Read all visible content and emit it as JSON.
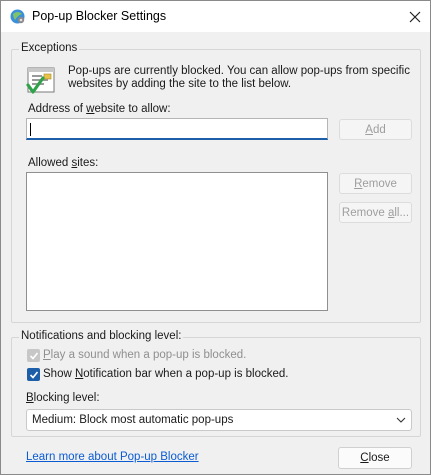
{
  "window": {
    "title": "Pop-up Blocker Settings",
    "close_glyph": "×",
    "app_icon": "ie-settings-icon"
  },
  "exceptions": {
    "group_title": "Exceptions",
    "info_line1": "Pop-ups are currently blocked.  You can allow pop-ups from specific",
    "info_line2": "websites by adding the site to the list below.",
    "address_label_pre": "Address of ",
    "address_label_key": "w",
    "address_label_post": "ebsite to allow:",
    "address_value": "",
    "add_button_key": "A",
    "add_button_rest": "dd",
    "allowed_label_pre": "Allowed ",
    "allowed_label_key": "s",
    "allowed_label_post": "ites:",
    "allowed_sites": [],
    "remove_button_key": "R",
    "remove_button_rest": "emove",
    "remove_all_button_pre": "Remove ",
    "remove_all_button_key": "a",
    "remove_all_button_post": "ll..."
  },
  "notifications": {
    "group_title": "Notifications and blocking level:",
    "play_sound": {
      "key": "P",
      "rest": "lay a sound when a pop-up is blocked.",
      "checked": true,
      "disabled": true
    },
    "show_bar": {
      "pre": "Show ",
      "key": "N",
      "rest": "otification bar when a pop-up is blocked.",
      "checked": true,
      "disabled": false
    },
    "blocking_label_key": "B",
    "blocking_label_rest": "locking level:",
    "blocking_level_value": "Medium: Block most automatic pop-ups"
  },
  "footer": {
    "learn_more_link": "Learn more about Pop-up Blocker",
    "close_button_key": "C",
    "close_button_rest": "lose"
  },
  "colors": {
    "accent": "#1c5ea8",
    "link": "#0b5bd3",
    "disabled_text": "#9e9e9e"
  }
}
